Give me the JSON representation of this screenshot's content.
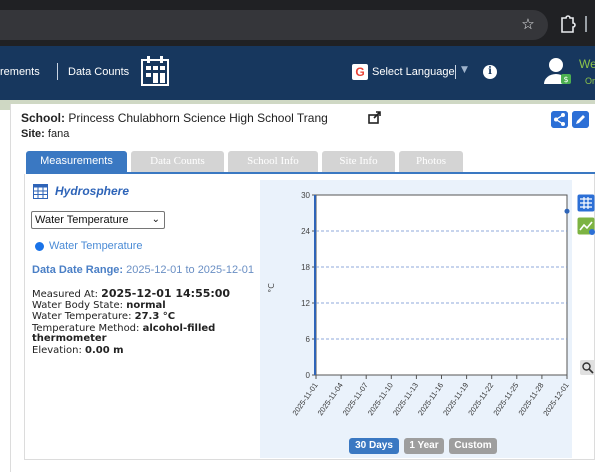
{
  "browser": {
    "star_icon": "star-icon",
    "extension_icon": "puzzle-icon"
  },
  "header": {
    "nav_measurements": "rements",
    "nav_data_counts": "Data Counts",
    "select_language": "Select Language",
    "user_text_1": "We",
    "user_text_2": "Or"
  },
  "panel": {
    "school_label": "School:",
    "school_name": "Princess Chulabhorn Science High School Trang",
    "site_label": "Site:",
    "site_name": "fana"
  },
  "tabs": [
    {
      "label": "Measurements",
      "active": true
    },
    {
      "label": "Data Counts",
      "active": false
    },
    {
      "label": "School Info",
      "active": false
    },
    {
      "label": "Site Info",
      "active": false
    },
    {
      "label": "Photos",
      "active": false
    }
  ],
  "measurements": {
    "section_title": "Hydrosphere",
    "selected_parameter": "Water Temperature",
    "radio_label": "Water Temperature",
    "date_range_label": "Data Date Range:",
    "date_range_value": "2025-12-01 to 2025-12-01",
    "measured_at_label": "Measured At:",
    "measured_at_value": "2025-12-01 14:55:00",
    "water_body_label": "Water Body State:",
    "water_body_value": "normal",
    "water_temp_label": "Water Temperature:",
    "water_temp_value": "27.3 °C",
    "temp_method_label": "Temperature Method:",
    "temp_method_value_1": "alcohol-filled",
    "temp_method_value_2": "thermometer",
    "elevation_label": "Elevation:",
    "elevation_value": "0.00 m"
  },
  "range_buttons": {
    "days30": "30 Days",
    "year1": "1 Year",
    "custom": "Custom"
  },
  "colors": {
    "header_bg": "#17375e",
    "accent": "#3a78c2",
    "chart_bg": "#eaf2fb",
    "series": "#2e64b8"
  },
  "chart_data": {
    "type": "line",
    "title": "",
    "xlabel": "",
    "ylabel": "°C",
    "ylim": [
      0,
      30
    ],
    "yticks": [
      "0",
      "6",
      "12",
      "18",
      "24",
      "30"
    ],
    "xticks": [
      "2025-11-01",
      "2025-11-04",
      "2025-11-07",
      "2025-11-10",
      "2025-11-13",
      "2025-11-16",
      "2025-11-19",
      "2025-11-22",
      "2025-11-25",
      "2025-11-28",
      "2025-12-01"
    ],
    "grid": true,
    "series": [
      {
        "x": [
          "2025-12-01"
        ],
        "values": [
          27.3
        ]
      }
    ]
  }
}
